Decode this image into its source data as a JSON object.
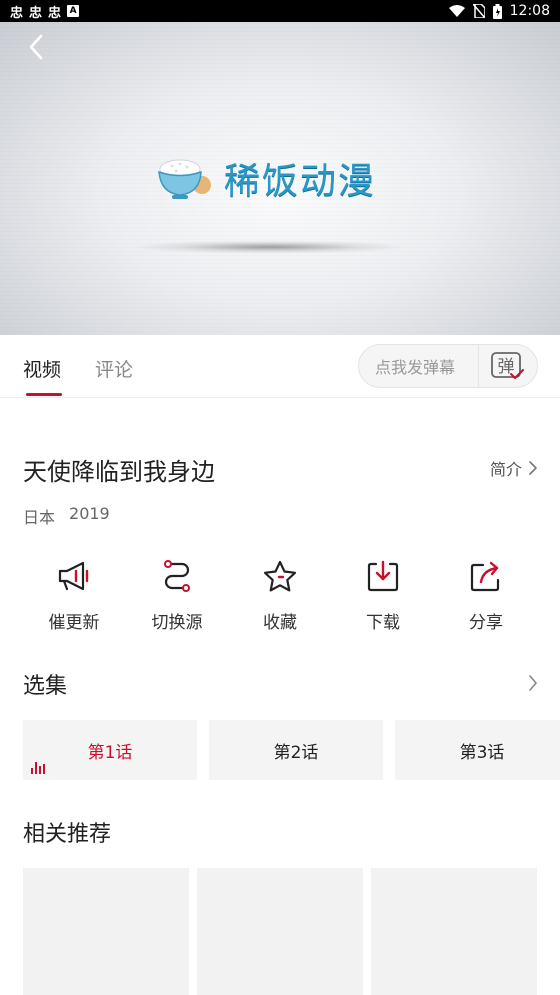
{
  "status_bar": {
    "notif_icons": [
      "忠",
      "忠",
      "忠"
    ],
    "time": "12:08"
  },
  "video": {
    "logo_text": "稀饭动漫"
  },
  "tabs": [
    {
      "label": "视频",
      "active": true
    },
    {
      "label": "评论",
      "active": false
    }
  ],
  "danmaku": {
    "placeholder": "点我发弹幕",
    "button_label": "弹"
  },
  "show": {
    "title": "天使降临到我身边",
    "intro_label": "简介",
    "region": "日本",
    "year": "2019"
  },
  "actions": [
    {
      "label": "催更新",
      "icon": "megaphone-icon"
    },
    {
      "label": "切换源",
      "icon": "switch-source-icon"
    },
    {
      "label": "收藏",
      "icon": "star-icon"
    },
    {
      "label": "下载",
      "icon": "download-icon"
    },
    {
      "label": "分享",
      "icon": "share-icon"
    }
  ],
  "episodes": {
    "section_title": "选集",
    "items": [
      {
        "label": "第1话",
        "active": true
      },
      {
        "label": "第2话",
        "active": false
      },
      {
        "label": "第3话",
        "active": false
      }
    ]
  },
  "recommend": {
    "section_title": "相关推荐"
  },
  "colors": {
    "accent": "#c8102e",
    "logo_blue": "#2a97c7"
  }
}
